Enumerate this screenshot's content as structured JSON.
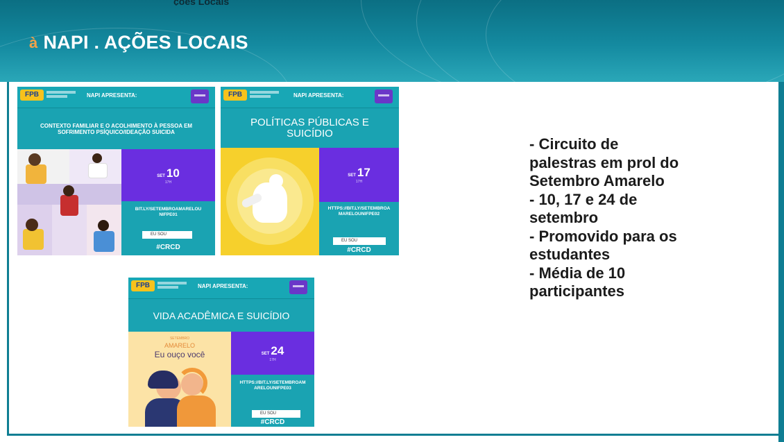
{
  "header": {
    "top_text": "ções Locais",
    "title": "NAPI . AÇÕES LOCAIS",
    "bullet": "à"
  },
  "posters": [
    {
      "logo": "FPB",
      "label": "NAPI APRESENTA:",
      "title": "CONTEXTO FAMILIAR E O ACOLHIMENTO À PESSOA EM SOFRIMENTO PSÍQUICO/IDEAÇÃO SUICIDA",
      "date_prefix": "SET",
      "date_day": "10",
      "date_hour": "17H",
      "link": "BIT.LY/SETEMBROAMARELOUNIFPE01",
      "eusou": "EU SOU",
      "hashtag": "#CRCD"
    },
    {
      "logo": "FPB",
      "label": "NAPI APRESENTA:",
      "title": "POLÍTICAS PÚBLICAS E SUICÍDIO",
      "date_prefix": "SET",
      "date_day": "17",
      "date_hour": "17H",
      "link": "HTTPS://BIT.LY/SETEMBROAMARELOUNIFPE02",
      "eusou": "EU SOU",
      "hashtag": "#CRCD"
    },
    {
      "logo": "FPB",
      "label": "NAPI APRESENTA:",
      "title": "VIDA ACADÊMICA E SUICÍDIO",
      "date_prefix": "SET",
      "date_day": "24",
      "date_hour": "17H",
      "link": "HTTPS://BIT.LY/SETEMBROAMARELOUNIFPE03",
      "eusou": "EU SOU",
      "hashtag": "#CRCD",
      "illustration_top": "SETEMBRO",
      "illustration_mid": "AMARELO",
      "illustration_text": "Eu ouço você"
    }
  ],
  "bullets": [
    "- Circuito de",
    "palestras em prol do",
    "Setembro Amarelo",
    "- 10, 17 e 24 de",
    "setembro",
    "- Promovido para os",
    "estudantes",
    "- Média de 10",
    "participantes"
  ]
}
